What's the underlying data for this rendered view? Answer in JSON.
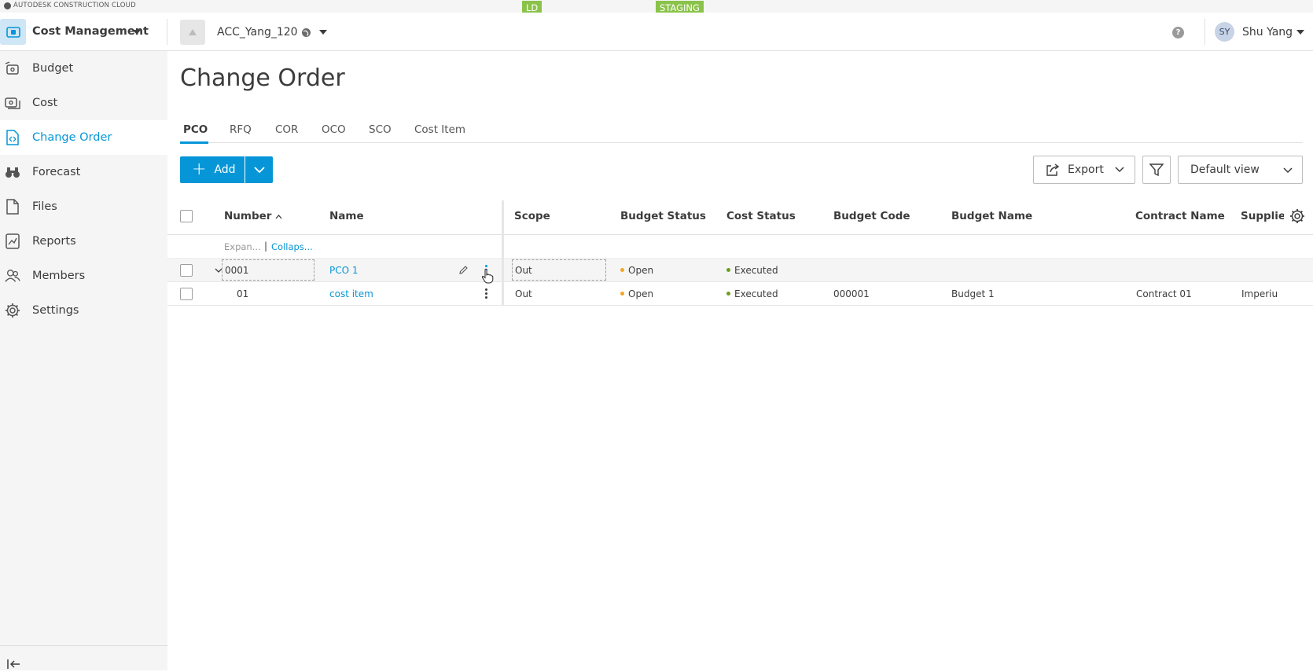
{
  "brand": "AUTODESK CONSTRUCTION CLOUD",
  "env_badges": {
    "ld": "LD",
    "staging": "STAGING"
  },
  "colors": {
    "accent": "#0696d7",
    "open_dot": "#f5a623",
    "executed_dot": "#6a9e1f",
    "badge": "#8bc34a"
  },
  "header": {
    "module": "Cost Management",
    "project": "ACC_Yang_120",
    "help": "?",
    "user_initials": "SY",
    "user_name": "Shu Yang"
  },
  "sidebar": {
    "items": [
      {
        "label": "Budget",
        "icon": "budget-icon"
      },
      {
        "label": "Cost",
        "icon": "cost-icon"
      },
      {
        "label": "Change Order",
        "icon": "change-order-icon",
        "active": true
      },
      {
        "label": "Forecast",
        "icon": "binoculars-icon"
      },
      {
        "label": "Files",
        "icon": "file-icon"
      },
      {
        "label": "Reports",
        "icon": "reports-icon"
      },
      {
        "label": "Members",
        "icon": "members-icon"
      },
      {
        "label": "Settings",
        "icon": "gear-icon"
      }
    ]
  },
  "page": {
    "title": "Change Order"
  },
  "tabs": [
    "PCO",
    "RFQ",
    "COR",
    "OCO",
    "SCO",
    "Cost Item"
  ],
  "toolbar": {
    "add_label": "Add",
    "export_label": "Export",
    "view_label": "Default view"
  },
  "table": {
    "columns": [
      "Number",
      "Name",
      "Scope",
      "Budget Status",
      "Cost Status",
      "Budget Code",
      "Budget Name",
      "Contract Name",
      "Supplie"
    ],
    "expand_label": "Expan...",
    "separator": "|",
    "collapse_label": "Collaps...",
    "rows": [
      {
        "number": "0001",
        "name": "PCO 1",
        "scope": "Out",
        "budget_status": "Open",
        "cost_status": "Executed",
        "budget_code": "",
        "budget_name": "",
        "contract_name": "",
        "supplier": ""
      },
      {
        "number": "01",
        "name": "cost item",
        "scope": "Out",
        "budget_status": "Open",
        "cost_status": "Executed",
        "budget_code": "000001",
        "budget_name": "Budget 1",
        "contract_name": "Contract 01",
        "supplier": "Imperiu"
      }
    ]
  }
}
